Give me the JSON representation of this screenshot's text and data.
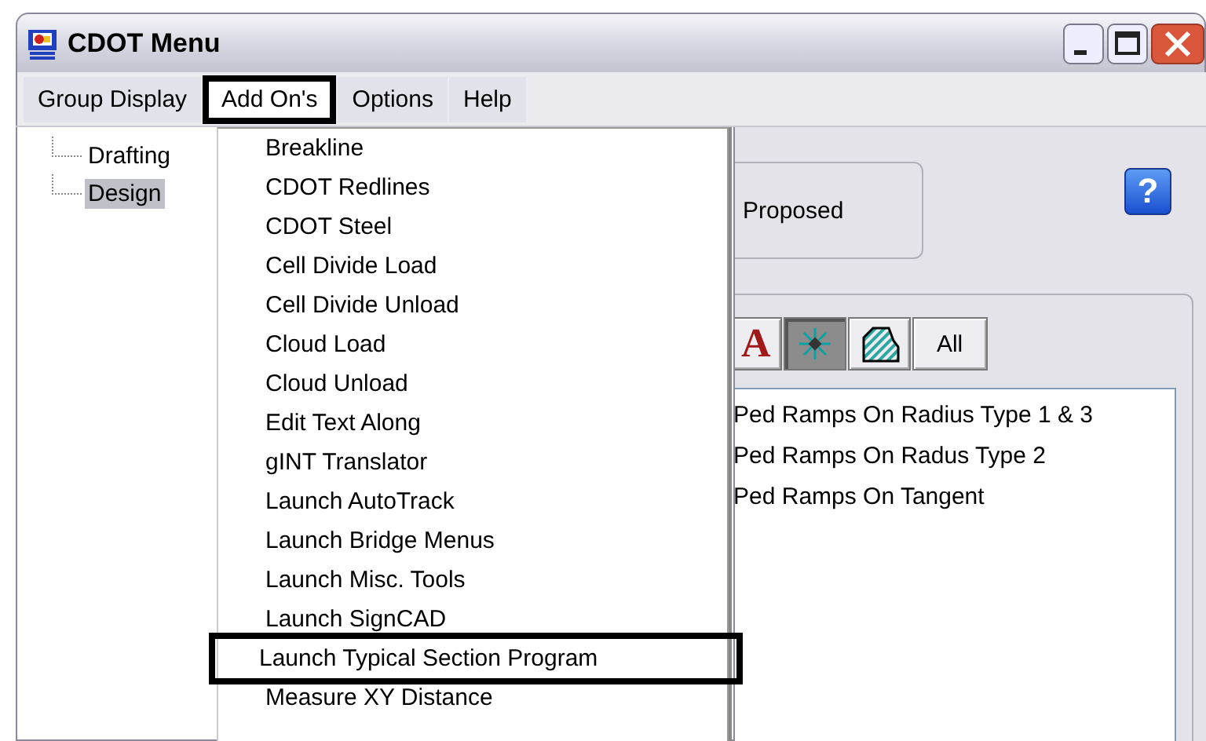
{
  "window": {
    "title": "CDOT Menu"
  },
  "menu_bar": [
    {
      "label": "Group Display",
      "callout": false
    },
    {
      "label": "Add On's",
      "callout": true
    },
    {
      "label": "Options",
      "callout": false
    },
    {
      "label": "Help",
      "callout": false
    }
  ],
  "tree": [
    {
      "label": "Drafting",
      "selected": false
    },
    {
      "label": "Design",
      "selected": true
    }
  ],
  "dropdown": [
    {
      "label": "Breakline",
      "callout": false
    },
    {
      "label": "CDOT Redlines",
      "callout": false
    },
    {
      "label": "CDOT Steel",
      "callout": false
    },
    {
      "label": "Cell Divide Load",
      "callout": false
    },
    {
      "label": "Cell Divide Unload",
      "callout": false
    },
    {
      "label": "Cloud Load",
      "callout": false
    },
    {
      "label": "Cloud Unload",
      "callout": false
    },
    {
      "label": "Edit Text Along",
      "callout": false
    },
    {
      "label": "gINT Translator",
      "callout": false
    },
    {
      "label": "Launch AutoTrack",
      "callout": false
    },
    {
      "label": "Launch Bridge Menus",
      "callout": false
    },
    {
      "label": "Launch Misc. Tools",
      "callout": false
    },
    {
      "label": "Launch SignCAD",
      "callout": false
    },
    {
      "label": "Launch Typical Section Program",
      "callout": true
    },
    {
      "label": "Measure XY Distance",
      "callout": false
    }
  ],
  "option_group": {
    "label": "Proposed"
  },
  "help_button": {
    "label": "?"
  },
  "toolbar": [
    {
      "kind": "letter",
      "label": "A",
      "pressed": false
    },
    {
      "kind": "star",
      "pressed": true
    },
    {
      "kind": "hatch",
      "pressed": false
    },
    {
      "kind": "text",
      "label": "All",
      "pressed": false
    }
  ],
  "list": [
    "Ped Ramps On Radius Type 1 & 3",
    "Ped Ramps On Radus Type 2",
    "Ped Ramps On Tangent"
  ]
}
